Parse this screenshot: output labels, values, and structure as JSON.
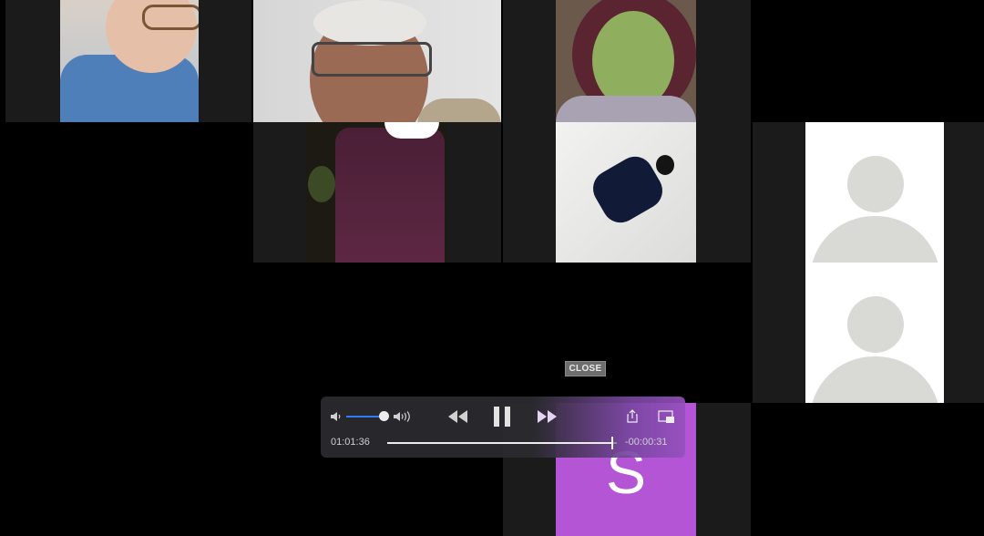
{
  "overlay": {
    "close_label": "CLOSE"
  },
  "player": {
    "elapsed": "01:01:36",
    "remaining": "-00:00:31",
    "progress": 0.98,
    "volume": 0.85
  },
  "participants": [
    {
      "id": "p1",
      "type": "video"
    },
    {
      "id": "p2",
      "type": "video"
    },
    {
      "id": "p3",
      "type": "video"
    },
    {
      "id": "p4",
      "type": "video"
    },
    {
      "id": "p5",
      "type": "video"
    },
    {
      "id": "p6",
      "type": "avatar-placeholder"
    },
    {
      "id": "p7",
      "type": "avatar-placeholder"
    },
    {
      "id": "p8",
      "type": "initial-avatar",
      "initial": "S",
      "color": "#b455d6"
    }
  ],
  "colors": {
    "avatar_bg": "#ffffff",
    "avatar_fg": "#d9d9d6",
    "accent_blue": "#2f7cf6",
    "initial_tile": "#b455d6"
  }
}
